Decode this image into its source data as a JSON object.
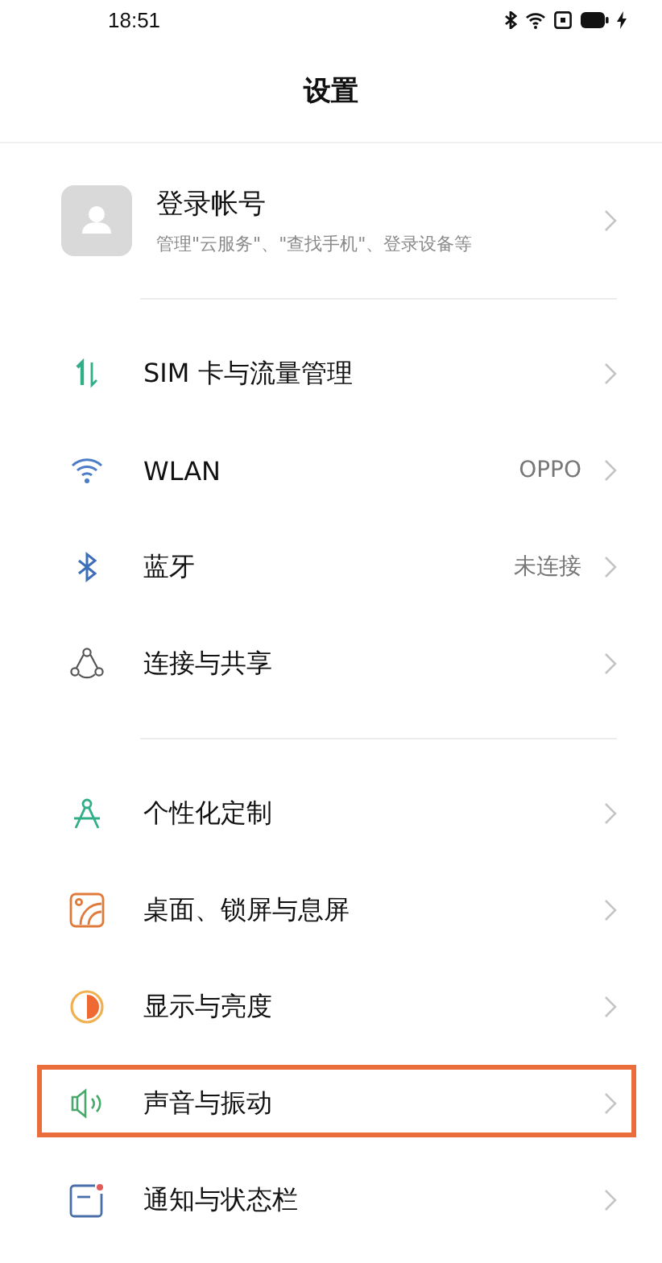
{
  "status_bar": {
    "time": "18:51"
  },
  "title": "设置",
  "account": {
    "title": "登录帐号",
    "subtitle": "管理\"云服务\"、\"查找手机\"、登录设备等"
  },
  "groups": [
    [
      {
        "kind": "sim",
        "label": "SIM 卡与流量管理",
        "highlighted": false
      },
      {
        "kind": "wifi",
        "label": "WLAN",
        "value": "OPPO",
        "highlighted": false
      },
      {
        "kind": "bluetooth",
        "label": "蓝牙",
        "value": "未连接",
        "highlighted": false
      },
      {
        "kind": "share",
        "label": "连接与共享",
        "highlighted": false
      }
    ],
    [
      {
        "kind": "compass",
        "label": "个性化定制",
        "highlighted": false
      },
      {
        "kind": "wallpaper",
        "label": "桌面、锁屏与息屏",
        "highlighted": false
      },
      {
        "kind": "display",
        "label": "显示与亮度",
        "highlighted": false
      },
      {
        "kind": "sound",
        "label": "声音与振动",
        "highlighted": true
      },
      {
        "kind": "notification",
        "label": "通知与状态栏",
        "highlighted": false
      }
    ]
  ]
}
